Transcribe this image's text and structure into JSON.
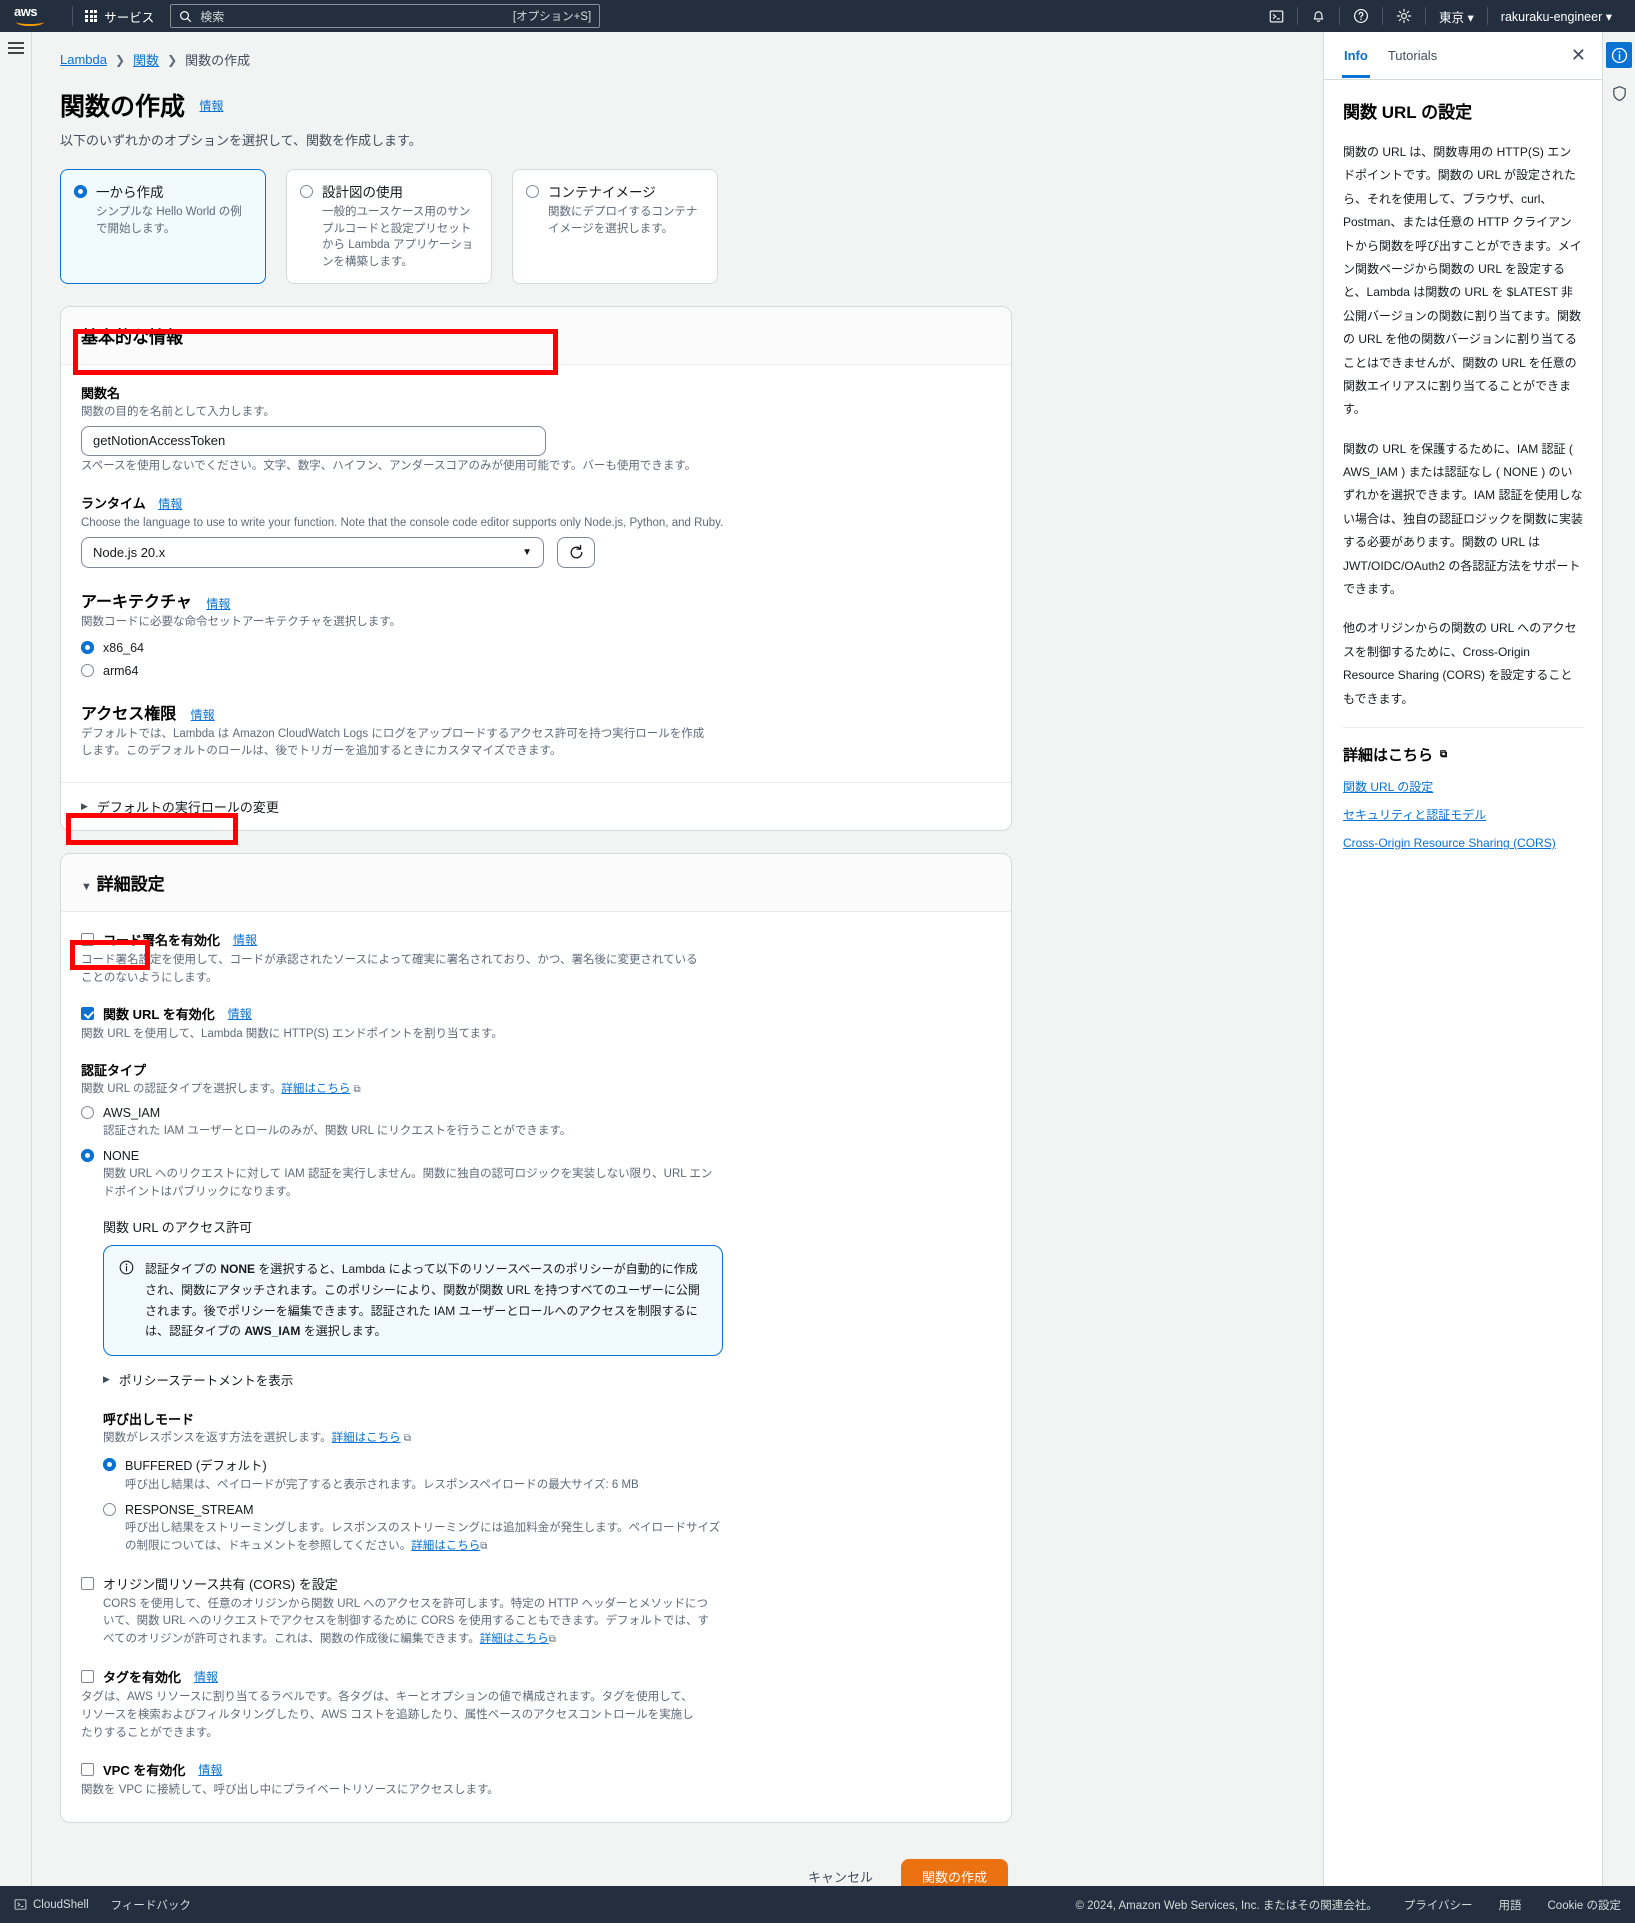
{
  "topnav": {
    "logo_text": "aws",
    "services_label": "サービス",
    "search_placeholder": "検索",
    "search_shortcut": "[オプション+S]",
    "icons": [
      "cloudshell-icon",
      "notifications-icon",
      "help-icon",
      "settings-icon"
    ],
    "region": "東京",
    "account": "rakuraku-engineer"
  },
  "breadcrumb": {
    "items": [
      {
        "label": "Lambda",
        "link": true
      },
      {
        "label": "関数",
        "link": true
      },
      {
        "label": "関数の作成",
        "link": false
      }
    ]
  },
  "page": {
    "title": "関数の作成",
    "info_label": "情報",
    "subtitle": "以下のいずれかのオプションを選択して、関数を作成します。"
  },
  "creation_options": [
    {
      "label": "一から作成",
      "desc": "シンプルな Hello World の例で開始します。",
      "selected": true
    },
    {
      "label": "設計図の使用",
      "desc": "一般的ユースケース用のサンプルコードと設定プリセットから Lambda アプリケーションを構築します。",
      "selected": false
    },
    {
      "label": "コンテナイメージ",
      "desc": "関数にデプロイするコンテナイメージを選択します。",
      "selected": false
    }
  ],
  "basic_info": {
    "heading": "基本的な情報",
    "function_name": {
      "label": "関数名",
      "help": "関数の目的を名前として入力します。",
      "value": "getNotionAccessToken",
      "help2": "スペースを使用しないでください。文字、数字、ハイフン、アンダースコアのみが使用可能です。バーも使用できます。"
    },
    "runtime": {
      "label": "ランタイム",
      "info_label": "情報",
      "help": "Choose the language to use to write your function. Note that the console code editor supports only Node.js, Python, and Ruby.",
      "value": "Node.js 20.x",
      "refresh_icon": "refresh-icon"
    },
    "architecture": {
      "label": "アーキテクチャ",
      "info_label": "情報",
      "help": "関数コードに必要な命令セットアーキテクチャを選択します。",
      "options": [
        {
          "label": "x86_64",
          "selected": true
        },
        {
          "label": "arm64",
          "selected": false
        }
      ]
    },
    "permissions": {
      "label": "アクセス権限",
      "info_label": "情報",
      "help": "デフォルトでは、Lambda は Amazon CloudWatch Logs にログをアップロードするアクセス許可を持つ実行ロールを作成します。このデフォルトのロールは、後でトリガーを追加するときにカスタマイズできます。"
    },
    "change_role_expander": "デフォルトの実行ロールの変更"
  },
  "advanced": {
    "heading": "詳細設定",
    "code_signing": {
      "label": "コード署名を有効化",
      "info_label": "情報",
      "checked": false,
      "desc": "コード署名設定を使用して、コードが承認されたソースによって確実に署名されており、かつ、署名後に変更されていることのないようにします。"
    },
    "function_url": {
      "label": "関数 URL を有効化",
      "info_label": "情報",
      "checked": true,
      "desc": "関数 URL を使用して、Lambda 関数に HTTP(S) エンドポイントを割り当てます。"
    },
    "auth_type": {
      "label": "認証タイプ",
      "help_prefix": "関数 URL の認証タイプを選択します。",
      "help_link": "詳細はこちら",
      "options": [
        {
          "label": "AWS_IAM",
          "selected": false,
          "desc": "認証された IAM ユーザーとロールのみが、関数 URL にリクエストを行うことができます。"
        },
        {
          "label": "NONE",
          "selected": true,
          "desc": "関数 URL へのリクエストに対して IAM 認証を実行しません。関数に独自の認可ロジックを実装しない限り、URL エンドポイントはパブリックになります。"
        }
      ]
    },
    "url_access": {
      "label": "関数 URL のアクセス許可",
      "alert_parts": [
        "認証タイプの ",
        "NONE",
        " を選択すると、Lambda によって以下のリソースベースのポリシーが自動的に作成され、関数にアタッチされます。このポリシーにより、関数が関数 URL を持つすべてのユーザーに公開されます。後でポリシーを編集できます。認証された IAM ユーザーとロールへのアクセスを制限するには、認証タイプの ",
        "AWS_IAM",
        " を選択します。"
      ],
      "policy_expander": "ポリシーステートメントを表示"
    },
    "invoke_mode": {
      "label": "呼び出しモード",
      "help_prefix": "関数がレスポンスを返す方法を選択します。",
      "help_link": "詳細はこちら",
      "options": [
        {
          "label": "BUFFERED (デフォルト)",
          "selected": true,
          "desc": "呼び出し結果は、ペイロードが完了すると表示されます。レスポンスペイロードの最大サイズ: 6 MB"
        },
        {
          "label": "RESPONSE_STREAM",
          "selected": false,
          "desc": "呼び出し結果をストリーミングします。レスポンスのストリーミングには追加料金が発生します。ペイロードサイズの制限については、ドキュメントを参照してください。",
          "desc_link": "詳細はこちら"
        }
      ]
    },
    "cors": {
      "label": "オリジン間リソース共有 (CORS) を設定",
      "checked": false,
      "desc": "CORS を使用して、任意のオリジンから関数 URL へのアクセスを許可します。特定の HTTP ヘッダーとメソッドについて、関数 URL へのリクエストでアクセスを制御するために CORS を使用することもできます。デフォルトでは、すべてのオリジンが許可されます。これは、関数の作成後に編集できます。",
      "desc_link": "詳細はこちら"
    },
    "tags": {
      "label": "タグを有効化",
      "info_label": "情報",
      "checked": false,
      "desc": "タグは、AWS リソースに割り当てるラベルです。各タグは、キーとオプションの値で構成されます。タグを使用して、リソースを検索およびフィルタリングしたり、AWS コストを追跡したり、属性ベースのアクセスコントロールを実施したりすることができます。"
    },
    "vpc": {
      "label": "VPC を有効化",
      "info_label": "情報",
      "checked": false,
      "desc": "関数を VPC に接続して、呼び出し中にプライベートリソースにアクセスします。"
    }
  },
  "form_actions": {
    "cancel": "キャンセル",
    "submit": "関数の作成"
  },
  "info_panel": {
    "tabs": [
      {
        "label": "Info",
        "active": true
      },
      {
        "label": "Tutorials",
        "active": false
      }
    ],
    "close_icon": "close-icon",
    "title": "関数 URL の設定",
    "paragraphs": [
      "関数の URL は、関数専用の HTTP(S) エンドポイントです。関数の URL が設定されたら、それを使用して、ブラウザ、curl、Postman、または任意の HTTP クライアントから関数を呼び出すことができます。メイン関数ページから関数の URL を設定すると、Lambda は関数の URL を $LATEST 非公開バージョンの関数に割り当てます。関数の URL を他の関数バージョンに割り当てることはできませんが、関数の URL を任意の関数エイリアスに割り当てることができます。",
      "関数の URL を保護するために、IAM 認証 ( AWS_IAM ) または認証なし ( NONE ) のいずれかを選択できます。IAM 認証を使用しない場合は、独自の認証ロジックを関数に実装する必要があります。関数の URL は JWT/OIDC/OAuth2 の各認証方法をサポートできます。",
      "他のオリジンからの関数の URL へのアクセスを制御するために、Cross-Origin Resource Sharing (CORS) を設定することもできます。"
    ],
    "more_title": "詳細はこちら",
    "more_links": [
      "関数 URL の設定",
      "セキュリティと認証モデル",
      "Cross-Origin Resource Sharing (CORS)"
    ]
  },
  "bottombar": {
    "cloudshell": "CloudShell",
    "feedback": "フィードバック",
    "copyright": "© 2024, Amazon Web Services, Inc. またはその関連会社。",
    "links": [
      "プライバシー",
      "用語",
      "Cookie の設定"
    ]
  }
}
